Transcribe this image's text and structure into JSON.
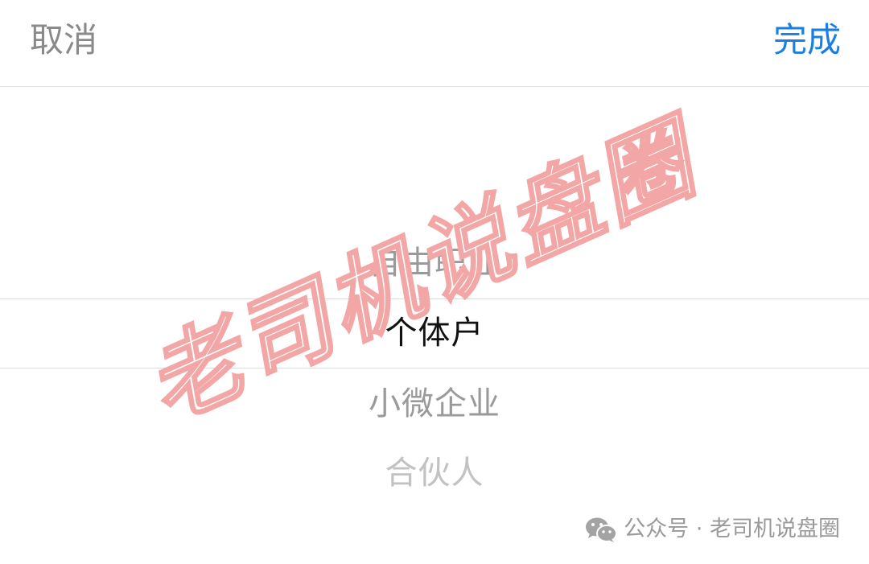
{
  "toolbar": {
    "cancel_label": "取消",
    "done_label": "完成"
  },
  "picker": {
    "options": [
      {
        "label": "自由职业"
      },
      {
        "label": "个体户"
      },
      {
        "label": "小微企业"
      },
      {
        "label": "合伙人"
      }
    ],
    "selected": "个体户"
  },
  "watermark": {
    "text": "老司机说盘圈"
  },
  "footer": {
    "text": "公众号 · 老司机说盘圈",
    "icon": "wechat-icon"
  },
  "colors": {
    "accent": "#1a7fe0",
    "cancel": "#8a8a8a",
    "selected_text": "#111111",
    "watermark_stroke": "#f3a6a6"
  }
}
